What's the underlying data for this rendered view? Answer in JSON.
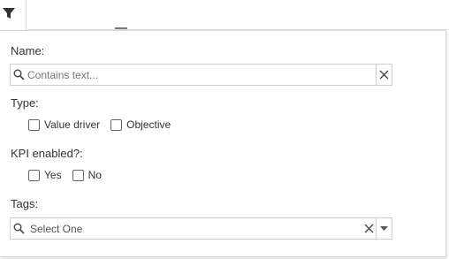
{
  "toolbar": {
    "filter_icon": "filter-icon"
  },
  "filters": {
    "name": {
      "label": "Name:",
      "placeholder": "Contains text...",
      "value": ""
    },
    "type": {
      "label": "Type:",
      "options": [
        {
          "label": "Value driver",
          "checked": false
        },
        {
          "label": "Objective",
          "checked": false
        }
      ]
    },
    "kpi": {
      "label": "KPI enabled?:",
      "options": [
        {
          "label": "Yes",
          "checked": false
        },
        {
          "label": "No",
          "checked": false
        }
      ]
    },
    "tags": {
      "label": "Tags:",
      "value": "Select One"
    }
  },
  "colors": {
    "border": "#cfcfcf",
    "text": "#333333",
    "icon": "#444444"
  }
}
